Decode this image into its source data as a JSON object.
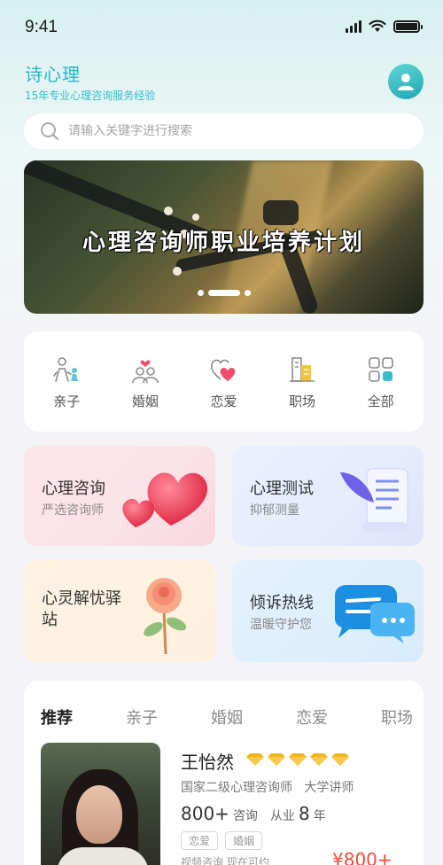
{
  "status": {
    "time": "9:41"
  },
  "brand": {
    "name": "诗心理",
    "tagline": "15年专业心理咨询服务经验"
  },
  "search": {
    "placeholder": "请输入关键字进行搜索"
  },
  "banner": {
    "title": "心理咨询师职业培养计划",
    "active_slide": 2,
    "slide_count": 3
  },
  "categories": [
    {
      "label": "亲子",
      "icon": "parent-child-icon"
    },
    {
      "label": "婚姻",
      "icon": "marriage-icon"
    },
    {
      "label": "恋爱",
      "icon": "love-heart-icon"
    },
    {
      "label": "职场",
      "icon": "workplace-icon"
    },
    {
      "label": "全部",
      "icon": "grid-icon"
    }
  ],
  "cards": [
    {
      "title": "心理咨询",
      "subtitle": "严选咨询师",
      "icon": "hearts-icon"
    },
    {
      "title": "心理测试",
      "subtitle": "抑郁测量",
      "icon": "scroll-quill-icon"
    },
    {
      "title": "心灵解忧驿站",
      "subtitle": "",
      "icon": "rose-icon"
    },
    {
      "title": "倾诉热线",
      "subtitle": "温暖守护您",
      "icon": "chat-bubble-icon"
    }
  ],
  "recommend": {
    "tabs": [
      "推荐",
      "亲子",
      "婚姻",
      "恋爱",
      "职场"
    ],
    "active_tab": 0,
    "counselor": {
      "name": "王怡然",
      "rating_gems": 5,
      "title": "国家二级心理咨询师",
      "role": "大学讲师",
      "consult_count": "800+",
      "consult_label": "咨询",
      "years_prefix": "从业",
      "years": "8",
      "years_suffix": "年",
      "tags": [
        "恋爱",
        "婚姻"
      ],
      "availability": "视频咨询  现在可约",
      "price": "¥800+"
    }
  },
  "colors": {
    "accent": "#26b7c6",
    "price": "#ee4b3a"
  }
}
